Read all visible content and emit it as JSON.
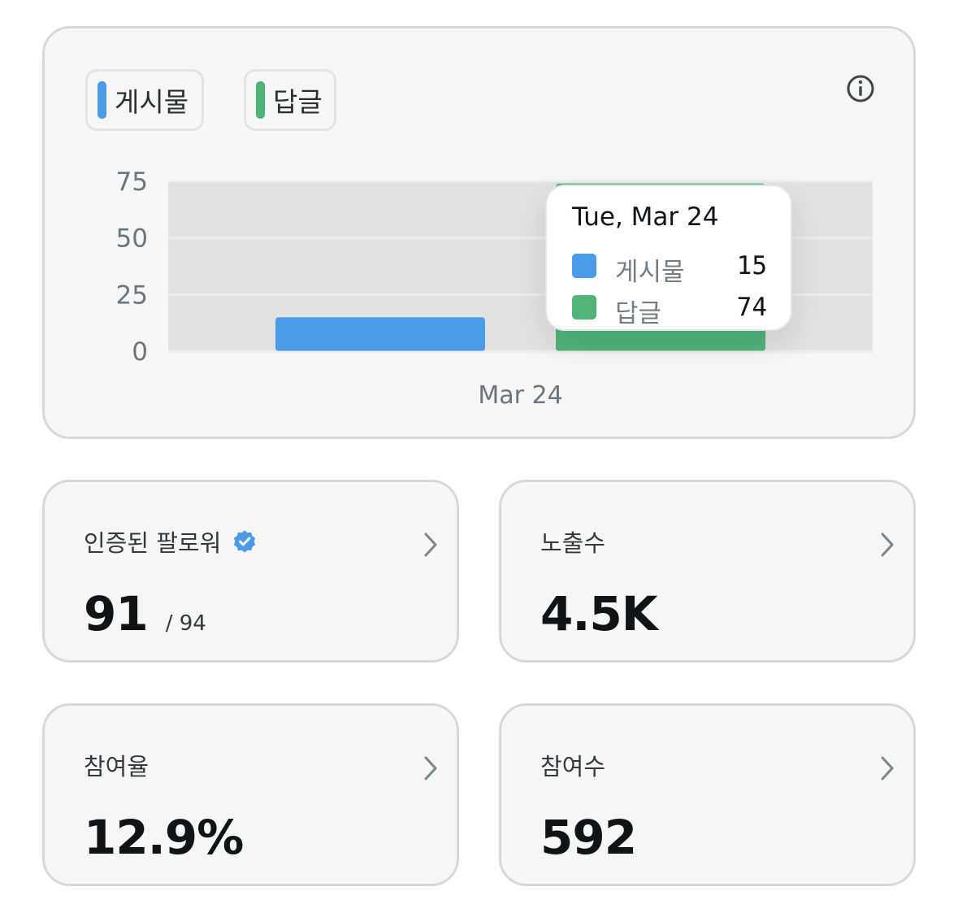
{
  "legend": {
    "posts_label": "게시물",
    "replies_label": "답글"
  },
  "colors": {
    "posts": "#4c9be8",
    "replies": "#50b47a",
    "card_bg": "#f5f6f6",
    "plot_bg": "#e1e2e3"
  },
  "chart_data": {
    "type": "bar",
    "categories": [
      "Mar 24"
    ],
    "series": [
      {
        "name": "게시물",
        "values": [
          15
        ]
      },
      {
        "name": "답글",
        "values": [
          74
        ]
      }
    ],
    "y_ticks": [
      "0",
      "25",
      "50",
      "75"
    ],
    "ylim": [
      0,
      75
    ],
    "grid": true,
    "xlabel": "",
    "ylabel": ""
  },
  "tooltip": {
    "date": "Tue, Mar 24",
    "rows": [
      {
        "name": "게시물",
        "value": "15"
      },
      {
        "name": "답글",
        "value": "74"
      }
    ]
  },
  "stats": {
    "verified_followers": {
      "title": "인증된 팔로워",
      "value": "91",
      "sub": "/ 94"
    },
    "impressions": {
      "title": "노출수",
      "value": "4.5K"
    },
    "engagement_rate": {
      "title": "참여율",
      "value": "12.9%"
    },
    "engagements": {
      "title": "참여수",
      "value": "592"
    }
  },
  "icons": {
    "info": "info-circle-icon",
    "chevron": "chevron-right-icon",
    "verified": "verified-badge-icon"
  }
}
